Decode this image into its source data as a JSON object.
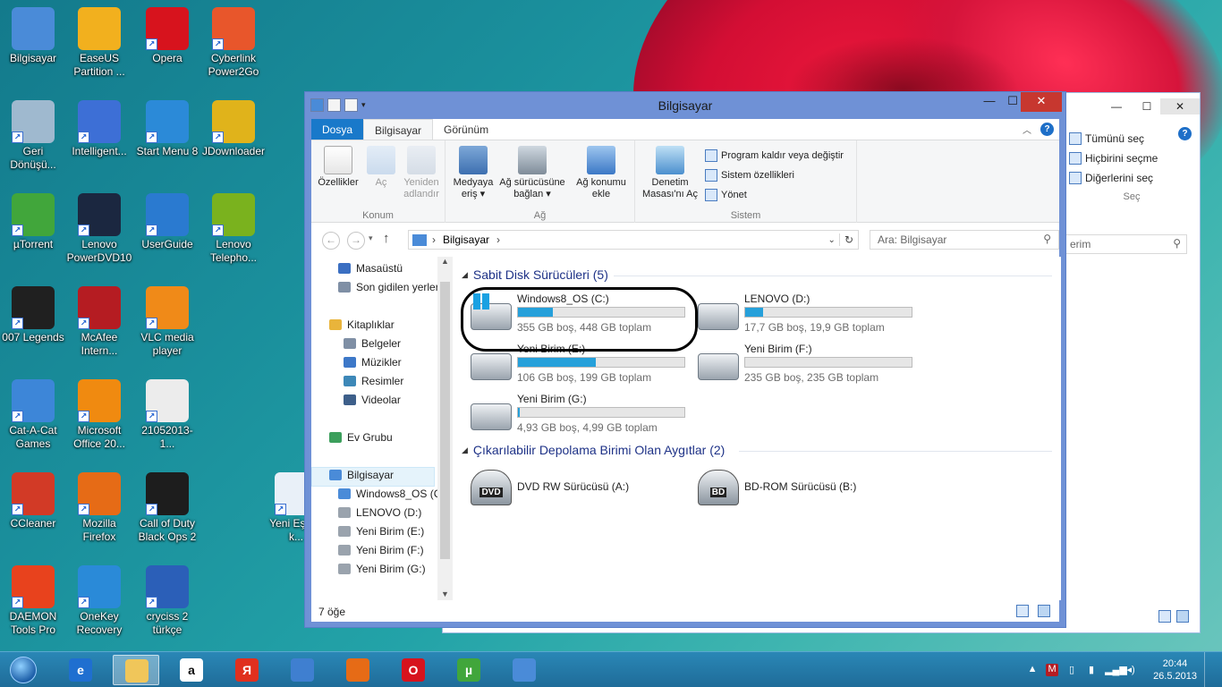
{
  "desktop": {
    "icons": [
      {
        "label": "Bilgisayar",
        "icon": "computer-icon",
        "color": "#4a8bd8"
      },
      {
        "label": "EaseUS Partition ...",
        "icon": "easeus-icon",
        "color": "#f2b01e"
      },
      {
        "label": "Opera",
        "icon": "opera-icon",
        "color": "#d7131d"
      },
      {
        "label": "Cyberlink Power2Go",
        "icon": "power2go-icon",
        "color": "#e8562b"
      },
      {
        "label": "Geri Dönüşü...",
        "icon": "recycle-bin-icon",
        "color": "#9fb9cf"
      },
      {
        "label": "Intelligent...",
        "icon": "intelligent-icon",
        "color": "#3d6fd6"
      },
      {
        "label": "Start Menu 8",
        "icon": "start-menu-icon",
        "color": "#2b8ad8"
      },
      {
        "label": "JDownloader",
        "icon": "jdownloader-icon",
        "color": "#e0b31b"
      },
      {
        "label": "µTorrent",
        "icon": "utorrent-icon",
        "color": "#41a63b"
      },
      {
        "label": "Lenovo PowerDVD10",
        "icon": "powerdvd-icon",
        "color": "#1b2740"
      },
      {
        "label": "UserGuide",
        "icon": "userguide-icon",
        "color": "#2a7ad0"
      },
      {
        "label": "Lenovo Telepho...",
        "icon": "telephony-icon",
        "color": "#7ab21e"
      },
      {
        "label": "007 Legends",
        "icon": "legends-icon",
        "color": "#202020"
      },
      {
        "label": "McAfee Intern...",
        "icon": "mcafee-icon",
        "color": "#b51c22"
      },
      {
        "label": "VLC media player",
        "icon": "vlc-icon",
        "color": "#f08a18"
      },
      {
        "label": "Cat-A-Cat Games",
        "icon": "cat-games-icon",
        "color": "#3d86d8"
      },
      {
        "label": "Microsoft Office 20...",
        "icon": "office-icon",
        "color": "#f08a10"
      },
      {
        "label": "21052013-1...",
        "icon": "document-icon",
        "color": "#ececec"
      },
      {
        "label": "CCleaner",
        "icon": "ccleaner-icon",
        "color": "#d23a26"
      },
      {
        "label": "Mozilla Firefox",
        "icon": "firefox-icon",
        "color": "#e66b16"
      },
      {
        "label": "Call of Duty Black Ops 2",
        "icon": "cod-icon",
        "color": "#1d1d1d"
      },
      {
        "label": "Yeni Eşlem k...",
        "icon": "sync-icon",
        "color": "#e9f0f8"
      },
      {
        "label": "DAEMON Tools Pro",
        "icon": "daemon-icon",
        "color": "#e8421d"
      },
      {
        "label": "OneKey Recovery",
        "icon": "onekey-icon",
        "color": "#2a8ad8"
      },
      {
        "label": "cryciss 2 türkçe",
        "icon": "word-doc-icon",
        "color": "#2b5fb8"
      }
    ]
  },
  "back_window": {
    "select_all": "Tümünü seç",
    "select_none": "Hiçbirini seçme",
    "invert": "Diğerlerini seç",
    "group_label": "Seç",
    "search_fragment": "erim"
  },
  "explorer": {
    "title": "Bilgisayar",
    "tabs": [
      "Dosya",
      "Bilgisayar",
      "Görünüm"
    ],
    "ribbon": {
      "properties": "Özellikler",
      "open": "Aç",
      "rename": "Yeniden adlandır",
      "group_location": "Konum",
      "access_media": "Medyaya eriş",
      "map_drive": "Ağ sürücüsüne bağlan",
      "add_location": "Ağ konumu ekle",
      "group_network": "Ağ",
      "control_panel": "Denetim Masası'nı Aç",
      "uninstall": "Program kaldır veya değiştir",
      "sys_props": "Sistem özellikleri",
      "manage": "Yönet",
      "group_system": "Sistem"
    },
    "address": "Bilgisayar",
    "search_placeholder": "Ara: Bilgisayar",
    "nav": [
      "Masaüstü",
      "Son gidilen yerler",
      "Kitaplıklar",
      "Belgeler",
      "Müzikler",
      "Resimler",
      "Videolar",
      "Ev Grubu",
      "Bilgisayar",
      "Windows8_OS (C:",
      "LENOVO (D:)",
      "Yeni Birim (E:)",
      "Yeni Birim (F:)",
      "Yeni Birim (G:)"
    ],
    "group_hdd": "Sabit Disk Sürücüleri (5)",
    "group_removable": "Çıkarılabilir Depolama Birimi Olan Aygıtlar (2)",
    "drives": [
      {
        "name": "Windows8_OS (C:)",
        "info": "355 GB boş, 448 GB toplam",
        "used_fraction": 0.21
      },
      {
        "name": "LENOVO (D:)",
        "info": "17,7 GB boş, 19,9 GB toplam",
        "used_fraction": 0.11
      },
      {
        "name": "Yeni Birim (E:)",
        "info": "106 GB boş, 199 GB toplam",
        "used_fraction": 0.47
      },
      {
        "name": "Yeni Birim (F:)",
        "info": "235 GB boş, 235 GB toplam",
        "used_fraction": 0.0
      },
      {
        "name": "Yeni Birim (G:)",
        "info": "4,93 GB boş, 4,99 GB toplam",
        "used_fraction": 0.01
      }
    ],
    "optical": [
      {
        "name": "DVD RW Sürücüsü (A:)",
        "badge": "DVD"
      },
      {
        "name": "BD-ROM Sürücüsü (B:)",
        "badge": "BD"
      }
    ],
    "status": "7 öğe"
  },
  "taskbar": {
    "clock_time": "20:44",
    "clock_date": "26.5.2013",
    "apps": [
      {
        "icon": "ie-icon",
        "color": "#1f6fd0",
        "glyph": "e"
      },
      {
        "icon": "file-explorer-icon",
        "color": "#f0c65a",
        "glyph": ""
      },
      {
        "icon": "amazon-icon",
        "color": "#ffffff",
        "glyph": "a"
      },
      {
        "icon": "yandex-icon",
        "color": "#e0301e",
        "glyph": "Я"
      },
      {
        "icon": "volume-app-icon",
        "color": "#3f7fd0",
        "glyph": ""
      },
      {
        "icon": "firefox-icon",
        "color": "#e66b16",
        "glyph": ""
      },
      {
        "icon": "opera-icon",
        "color": "#d7131d",
        "glyph": "O"
      },
      {
        "icon": "utorrent-icon",
        "color": "#41a63b",
        "glyph": "µ"
      },
      {
        "icon": "computer-icon",
        "color": "#4a8bd8",
        "glyph": ""
      }
    ]
  }
}
